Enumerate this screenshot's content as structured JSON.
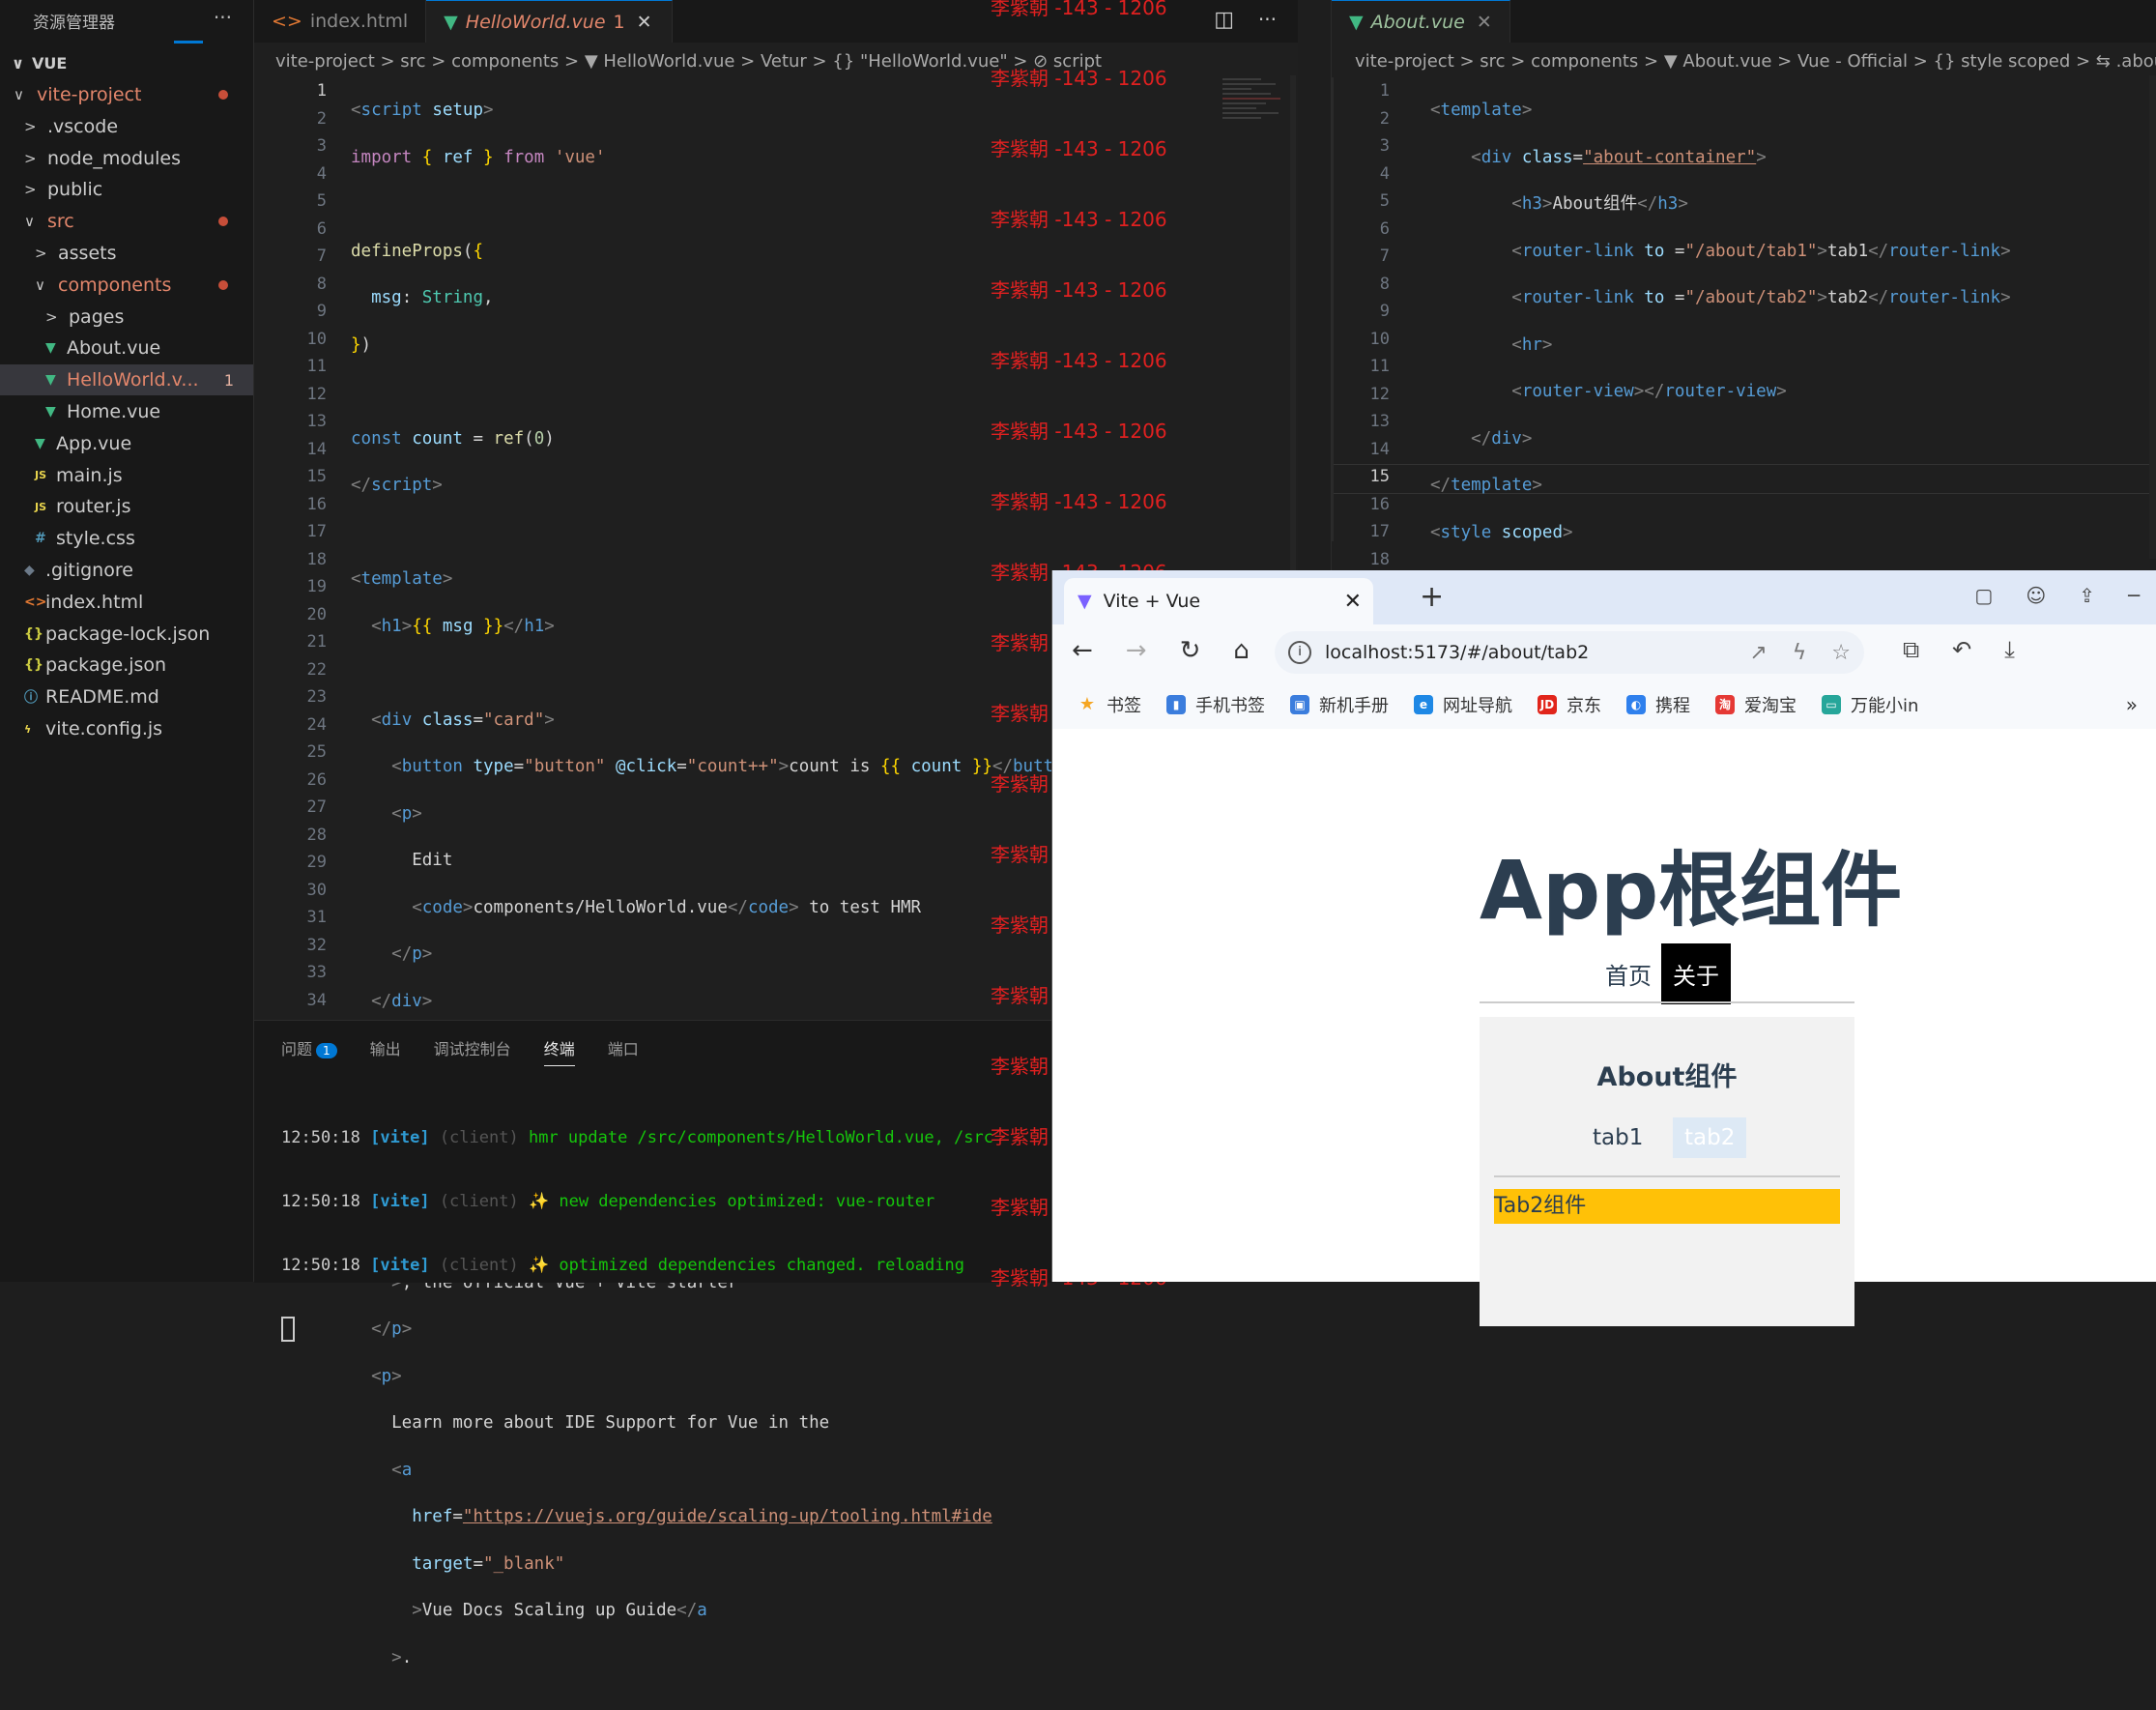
{
  "explorer": {
    "title": "资源管理器",
    "more": "···",
    "section": "VUE",
    "items": [
      {
        "label": "vite-project",
        "indent": 0,
        "chev": "∨",
        "icon": "",
        "mod": true,
        "dot": true
      },
      {
        "label": ".vscode",
        "indent": 1,
        "chev": ">",
        "icon": "",
        "mod": false
      },
      {
        "label": "node_modules",
        "indent": 1,
        "chev": ">",
        "icon": "",
        "mod": false
      },
      {
        "label": "public",
        "indent": 1,
        "chev": ">",
        "icon": "",
        "mod": false
      },
      {
        "label": "src",
        "indent": 1,
        "chev": "∨",
        "icon": "",
        "mod": true,
        "dot": true
      },
      {
        "label": "assets",
        "indent": 2,
        "chev": ">",
        "icon": "",
        "mod": false
      },
      {
        "label": "components",
        "indent": 2,
        "chev": "∨",
        "icon": "",
        "mod": true,
        "dot": true
      },
      {
        "label": "pages",
        "indent": 3,
        "chev": ">",
        "icon": "",
        "mod": false
      },
      {
        "label": "About.vue",
        "indent": 3,
        "chev": "",
        "icon": "vue",
        "mod": false
      },
      {
        "label": "HelloWorld.v...",
        "indent": 3,
        "chev": "",
        "icon": "vue",
        "mod": true,
        "badge": "1",
        "selected": true
      },
      {
        "label": "Home.vue",
        "indent": 3,
        "chev": "",
        "icon": "vue",
        "mod": false
      },
      {
        "label": "App.vue",
        "indent": 2,
        "chev": "",
        "icon": "vue",
        "mod": false
      },
      {
        "label": "main.js",
        "indent": 2,
        "chev": "",
        "icon": "js",
        "mod": false
      },
      {
        "label": "router.js",
        "indent": 2,
        "chev": "",
        "icon": "js",
        "mod": false
      },
      {
        "label": "style.css",
        "indent": 2,
        "chev": "",
        "icon": "css",
        "mod": false
      },
      {
        "label": ".gitignore",
        "indent": 1,
        "chev": "",
        "icon": "git",
        "mod": false
      },
      {
        "label": "index.html",
        "indent": 1,
        "chev": "",
        "icon": "html",
        "mod": false
      },
      {
        "label": "package-lock.json",
        "indent": 1,
        "chev": "",
        "icon": "json",
        "mod": false
      },
      {
        "label": "package.json",
        "indent": 1,
        "chev": "",
        "icon": "json",
        "mod": false
      },
      {
        "label": "README.md",
        "indent": 1,
        "chev": "",
        "icon": "info",
        "mod": false
      },
      {
        "label": "vite.config.js",
        "indent": 1,
        "chev": "",
        "icon": "vite",
        "mod": false
      }
    ]
  },
  "editor1": {
    "tabs": [
      {
        "label": "index.html",
        "icon": "<>"
      },
      {
        "label": "HelloWorld.vue",
        "icon": "▼",
        "badge": "1",
        "close": "✕"
      }
    ],
    "split_icon": "◫",
    "more": "···",
    "breadcrumb": "vite-project > src > components > ▼ HelloWorld.vue > Vetur > {} \"HelloWorld.vue\" > ⊘ script",
    "line_numbers": [
      "1",
      "2",
      "3",
      "4",
      "5",
      "6",
      "7",
      "8",
      "9",
      "10",
      "11",
      "12",
      "13",
      "14",
      "15",
      "16",
      "17",
      "18",
      "19",
      "20",
      "21",
      "22",
      "23",
      "24",
      "25",
      "26",
      "27",
      "28",
      "29",
      "30",
      "31",
      "32",
      "33",
      "34"
    ]
  },
  "editor2": {
    "tab": "About.vue",
    "breadcrumb": "vite-project > src > components > ▼ About.vue > Vue - Official > {} style scoped > ⇆ .about-",
    "line_numbers": [
      "1",
      "2",
      "3",
      "4",
      "5",
      "6",
      "7",
      "8",
      "9",
      "10",
      "11",
      "12",
      "13",
      "14",
      "15",
      "16",
      "17",
      "18"
    ]
  },
  "terminal": {
    "tabs": [
      "问题",
      "输出",
      "调试控制台",
      "终端",
      "端口"
    ],
    "problem_count": "1",
    "lines": [
      {
        "time": "12:50:18",
        "tag": "[vite]",
        "src": "(client)",
        "msg": "hmr update /src/components/HelloWorld.vue, /src"
      },
      {
        "time": "12:50:18",
        "tag": "[vite]",
        "src": "(client)",
        "msg": "✨ new dependencies optimized: vue-router"
      },
      {
        "time": "12:50:18",
        "tag": "[vite]",
        "src": "(client)",
        "msg": "✨ optimized dependencies changed. reloading"
      }
    ]
  },
  "watermark": "李紫朝 -143 - 1206",
  "browser": {
    "tab_title": "Vite + Vue",
    "url": "localhost:5173/#/about/tab2",
    "bookmarks": [
      "书签",
      "手机书签",
      "新机手册",
      "网址导航",
      "京东",
      "携程",
      "爱淘宝",
      "万能小in"
    ],
    "more": "»",
    "page": {
      "h1": "App根组件",
      "nav": [
        "首页",
        "关于"
      ],
      "about_title": "About组件",
      "tabs": [
        "tab1",
        "tab2"
      ],
      "content": "Tab2组件"
    }
  }
}
